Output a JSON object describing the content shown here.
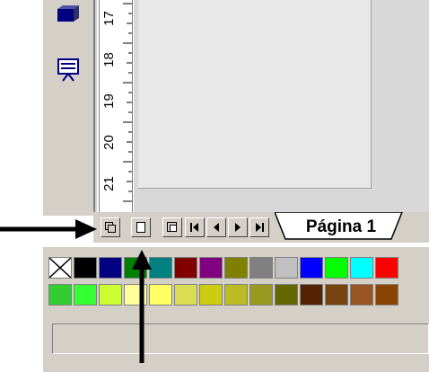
{
  "ruler": {
    "labels": [
      "21",
      "20",
      "19",
      "18",
      "17"
    ]
  },
  "tab": {
    "label": "Página 1"
  },
  "nav": [
    {
      "name": "layout-mode-button",
      "icon": "layout-icon"
    },
    {
      "name": "page-mode-button",
      "icon": "page-icon"
    },
    {
      "name": "master-mode-button",
      "icon": "master-icon"
    },
    {
      "name": "first-page-button",
      "icon": "first-page-icon"
    },
    {
      "name": "prev-page-button",
      "icon": "prev-page-icon"
    },
    {
      "name": "next-page-button",
      "icon": "next-page-icon"
    },
    {
      "name": "last-page-button",
      "icon": "last-page-icon"
    }
  ],
  "palette": {
    "row1": [
      "none",
      "#000000",
      "#000080",
      "#008000",
      "#008080",
      "#800000",
      "#800080",
      "#808000",
      "#808080",
      "#c0c0c0",
      "#0000ff",
      "#00ff00",
      "#00ffff",
      "#ff0000"
    ],
    "row2": [
      "#33cc33",
      "#33ff33",
      "#ccff33",
      "#ffff99",
      "#ffff66",
      "#dddd55",
      "#cccc11",
      "#bbbb22",
      "#999922",
      "#666600",
      "#552200",
      "#774411",
      "#995522",
      "#884400"
    ]
  }
}
